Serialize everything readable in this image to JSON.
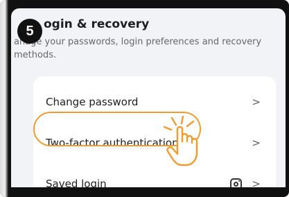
{
  "step_badge": "5",
  "page": {
    "title": "ogin & recovery",
    "subtitle": "anage your passwords, login preferences and recovery methods."
  },
  "rows": [
    {
      "label": "Change password"
    },
    {
      "label": "Two-factor authentication"
    },
    {
      "label": "Saved login"
    }
  ],
  "chevron_glyph": ">",
  "icons": {
    "saved_login_trailing": "instagram-icon",
    "pointer": "tap-hand-icon"
  },
  "colors": {
    "highlight": "#f39a2b",
    "background": "#f1f3f6",
    "card": "#ffffff"
  }
}
